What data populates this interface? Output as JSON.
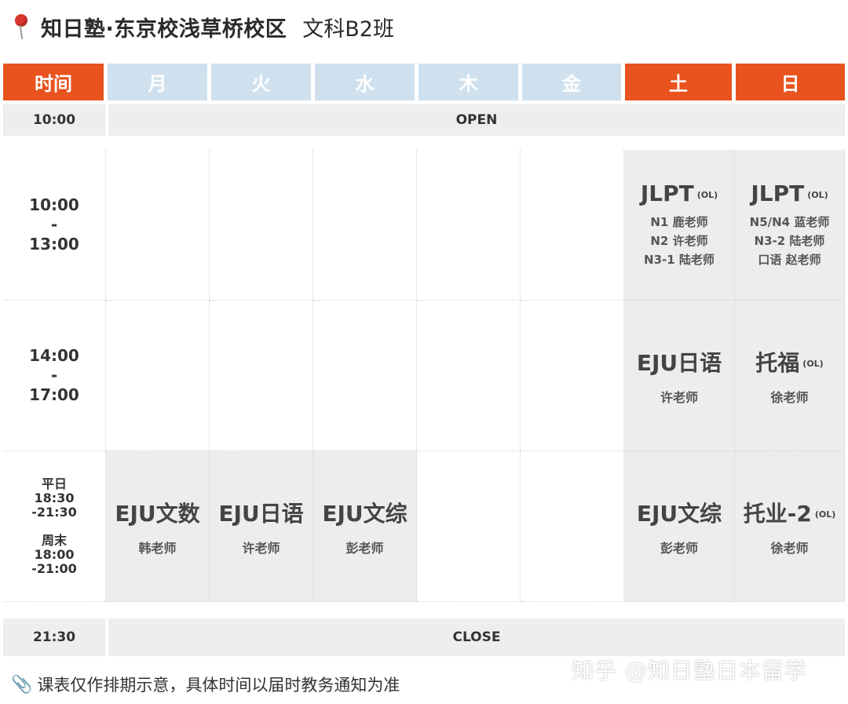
{
  "title": {
    "school": "知日塾·东京校浅草桥校区",
    "class_name": "文科B2班"
  },
  "header": {
    "time": "时间",
    "days": [
      "月",
      "火",
      "水",
      "木",
      "金",
      "土",
      "日"
    ]
  },
  "open_row": {
    "time": "10:00",
    "label": "OPEN"
  },
  "close_row": {
    "time": "21:30",
    "label": "CLOSE"
  },
  "slots": [
    {
      "time_lines": [
        "10:00",
        "-",
        "13:00"
      ]
    },
    {
      "time_lines": [
        "14:00",
        "-",
        "17:00"
      ]
    },
    {
      "time_lines": [
        "平日",
        "18:30",
        "-21:30",
        "",
        "周末",
        "18:00",
        "-21:00"
      ]
    }
  ],
  "courses": {
    "jlpt_sat": {
      "name": "JLPT",
      "tag": "(OL)",
      "lines": [
        "N1 鹿老师",
        "N2 许老师",
        "N3-1 陆老师"
      ]
    },
    "jlpt_sun": {
      "name": "JLPT",
      "tag": "(OL)",
      "lines": [
        "N5/N4 蓝老师",
        "N3-2 陆老师",
        "口语 赵老师"
      ]
    },
    "eju_jp_sat": {
      "name": "EJU日语",
      "teacher": "许老师"
    },
    "toefl_sun": {
      "name": "托福",
      "tag": "(OL)",
      "teacher": "徐老师"
    },
    "eju_math_mon": {
      "name": "EJU文数",
      "teacher": "韩老师"
    },
    "eju_jp_tue": {
      "name": "EJU日语",
      "teacher": "许老师"
    },
    "eju_comp_wed": {
      "name": "EJU文综",
      "teacher": "彭老师"
    },
    "eju_comp_sat": {
      "name": "EJU文综",
      "teacher": "彭老师"
    },
    "toeic_sun": {
      "name": "托业-2",
      "tag": "(OL)",
      "teacher": "徐老师"
    }
  },
  "footer": {
    "note": "课表仅作排期示意，具体时间以届时教务通知为准"
  },
  "watermark": "知乎 @知日塾日本留学",
  "colors": {
    "weekend_header": "#e8531e",
    "weekday_header": "#cfe1ef",
    "band": "#eeeeee",
    "course_cell": "#ededed"
  },
  "icons": {
    "title": "map-pin-icon",
    "footer": "paperclip-icon"
  }
}
